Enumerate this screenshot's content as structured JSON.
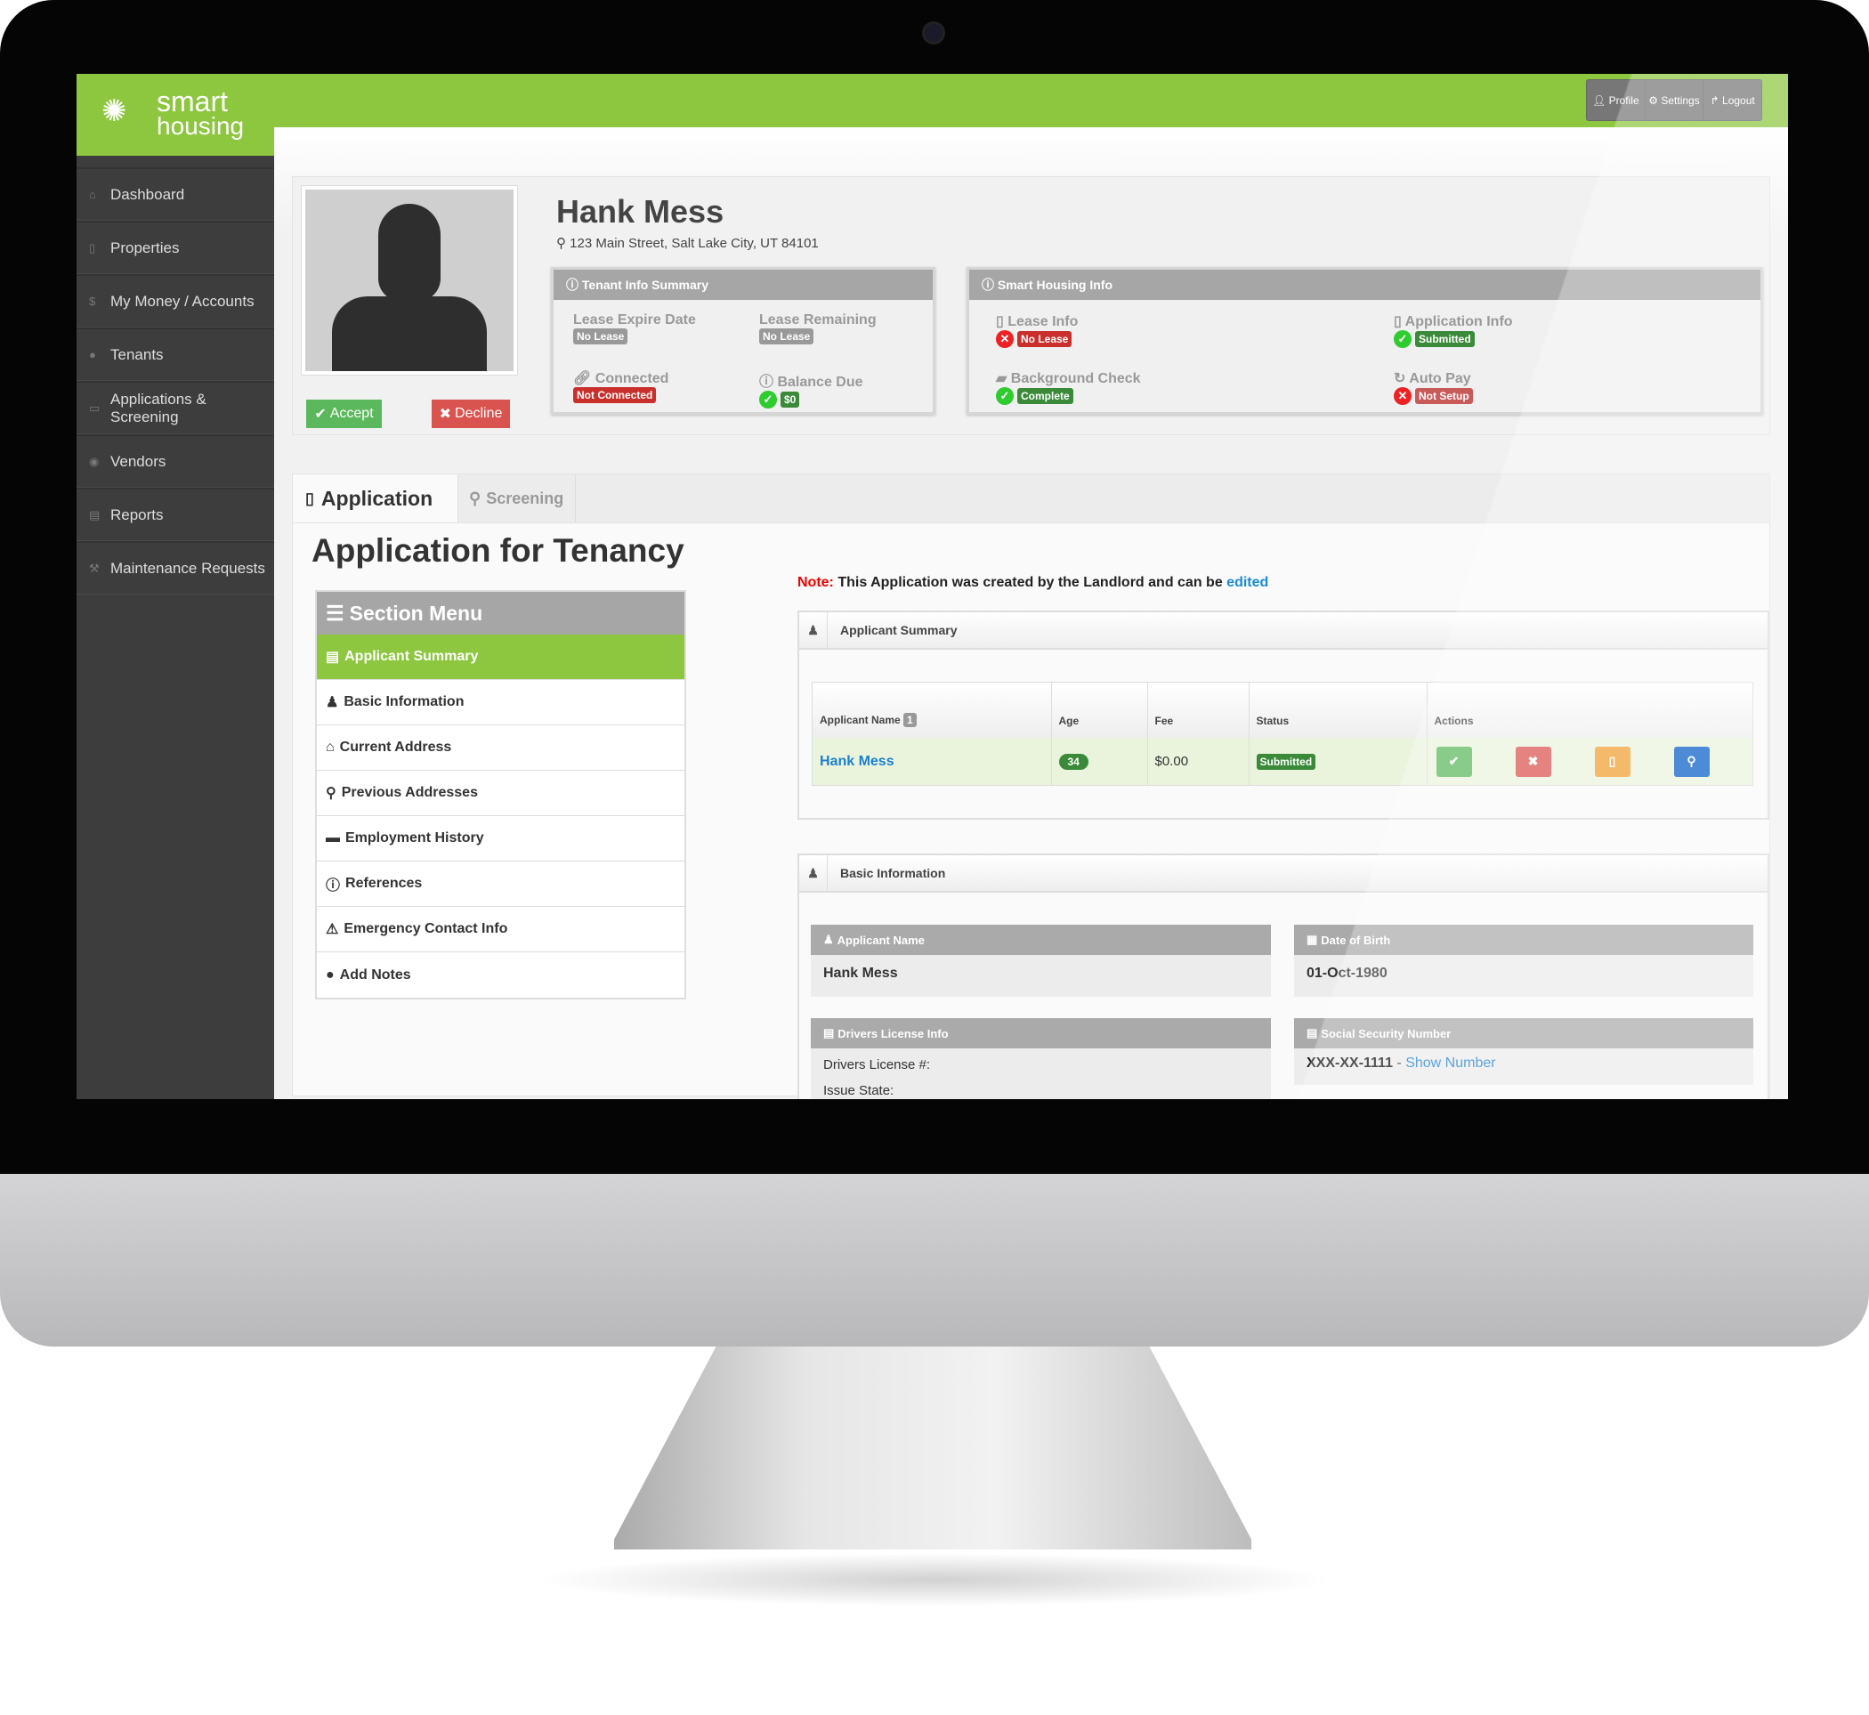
{
  "brand": {
    "logo_line1": "smart",
    "logo_line2": "housing",
    "accent": "#8dc63f"
  },
  "top_nav": [
    {
      "label": "Profile",
      "icon": "user-icon"
    },
    {
      "label": "Settings",
      "icon": "gear-icon"
    },
    {
      "label": "Logout",
      "icon": "logout-icon"
    }
  ],
  "sidebar": {
    "items": [
      {
        "label": "Dashboard",
        "icon": "home-icon"
      },
      {
        "label": "Properties",
        "icon": "building-icon"
      },
      {
        "label": "My Money / Accounts",
        "icon": "dollar-icon"
      },
      {
        "label": "Tenants",
        "icon": "users-icon"
      },
      {
        "label": "Applications & Screening",
        "icon": "file-icon"
      },
      {
        "label": "Vendors",
        "icon": "vendor-icon"
      },
      {
        "label": "Reports",
        "icon": "chart-icon"
      },
      {
        "label": "Maintenance Requests",
        "icon": "wrench-icon"
      }
    ]
  },
  "profile": {
    "name": "Hank Mess",
    "address": "123 Main Street, Salt Lake City, UT 84101",
    "accept_label": "Accept",
    "decline_label": "Decline"
  },
  "tenant_info": {
    "title": "Tenant Info Summary",
    "fields": [
      {
        "label": "Lease Expire Date",
        "value": "No Lease"
      },
      {
        "label": "Lease Remaining",
        "value": "No Lease"
      },
      {
        "label": "Connected",
        "value": "Not Connected"
      },
      {
        "label": "Balance Due",
        "value": "$0"
      }
    ]
  },
  "smart_info": {
    "title": "Smart Housing Info",
    "fields": [
      {
        "label": "Lease Info",
        "value": "No Lease"
      },
      {
        "label": "Application Info",
        "value": "Submitted"
      },
      {
        "label": "Background Check",
        "value": "Complete"
      },
      {
        "label": "Auto Pay",
        "value": "Not Setup"
      }
    ]
  },
  "tabs": [
    {
      "label": "Application",
      "active": true
    },
    {
      "label": "Screening",
      "active": false
    }
  ],
  "page_title": "Application for Tenancy",
  "section_menu": {
    "title": "Section Menu",
    "items": [
      "Applicant Summary",
      "Basic Information",
      "Current Address",
      "Previous Addresses",
      "Employment History",
      "References",
      "Emergency Contact Info",
      "Add Notes"
    ]
  },
  "note": {
    "prefix": "Note:",
    "text": "This Application was created by the Landlord and can be",
    "link": "edited"
  },
  "applicant_summary": {
    "title": "Applicant Summary",
    "columns": [
      "Applicant Name",
      "Age",
      "Fee",
      "Status",
      "Actions"
    ],
    "count": "1",
    "rows": [
      {
        "name": "Hank Mess",
        "age": "34",
        "fee": "$0.00",
        "status": "Submitted"
      }
    ]
  },
  "basic_info": {
    "title": "Basic Information",
    "applicant_name_label": "Applicant Name",
    "applicant_name": "Hank Mess",
    "dob_label": "Date of Birth",
    "dob": "01-Oct-1980",
    "dl_label": "Drivers License Info",
    "dl_number_label": "Drivers License #:",
    "dl_state_label": "Issue State:",
    "ssn_label": "Social Security Number",
    "ssn": "XXX-XX-1111",
    "ssn_sep": " - ",
    "ssn_link": "Show Number"
  }
}
